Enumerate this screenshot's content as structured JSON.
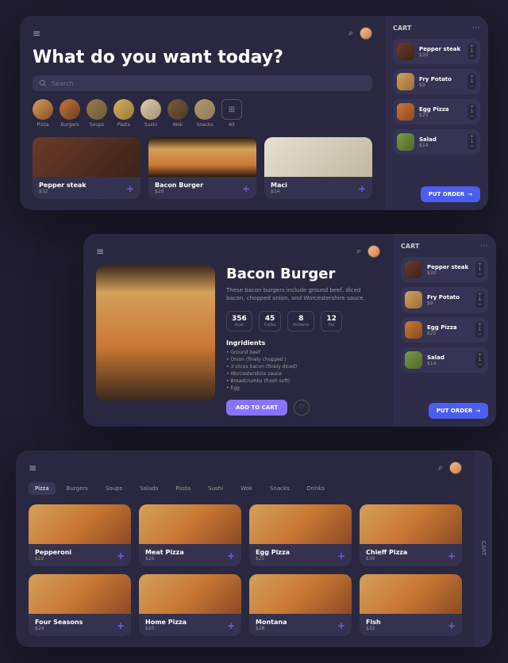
{
  "home": {
    "hero": "What do you want today?",
    "search_placeholder": "Search",
    "categories": [
      {
        "label": "Pizza"
      },
      {
        "label": "Burgers"
      },
      {
        "label": "Soups"
      },
      {
        "label": "Pasta"
      },
      {
        "label": "Sushi"
      },
      {
        "label": "Wok"
      },
      {
        "label": "Snacks"
      }
    ],
    "cat_all": "All",
    "cards": [
      {
        "name": "Pepper steak",
        "price": "$32",
        "cls": "steak"
      },
      {
        "name": "Bacon Burger",
        "price": "$20",
        "cls": "burger"
      },
      {
        "name": "Maci",
        "price": "$14",
        "cls": "sushi"
      }
    ]
  },
  "cart": {
    "title": "CART",
    "put_order": "PUT ORDER",
    "items": [
      {
        "name": "Pepper steak",
        "price": "$30",
        "qty": "1",
        "cls": "steak"
      },
      {
        "name": "Fry Potato",
        "price": "$9",
        "qty": "1",
        "cls": "fries"
      },
      {
        "name": "Egg Pizza",
        "price": "$25",
        "qty": "1",
        "cls": "pizza"
      },
      {
        "name": "Salad",
        "price": "$14",
        "qty": "1",
        "cls": "salad"
      }
    ]
  },
  "detail": {
    "title": "Bacon Burger",
    "desc": "These bacon burgers include ground beef, diced bacon, chopped onion, and Worcestershire sauce.",
    "nutrition": [
      {
        "v": "356",
        "l": "Kcal"
      },
      {
        "v": "45",
        "l": "Carbs"
      },
      {
        "v": "8",
        "l": "Proteins"
      },
      {
        "v": "12",
        "l": "Fat"
      }
    ],
    "ing_title": "Ingridients",
    "ingredients": [
      "• Ground beef",
      "• Onion (finely chopped )",
      "• 3 slices bacon (finely diced)",
      "• Worcestershire sauce",
      "• Breadcrumbs (fresh soft)",
      "• Egg"
    ],
    "add_to_cart": "ADD TO CART"
  },
  "browse": {
    "tabs": [
      "Pizza",
      "Burgers",
      "Soups",
      "Salads",
      "Pasta",
      "Sushi",
      "Wok",
      "Snacks",
      "Drinks"
    ],
    "active_tab": 0,
    "cards": [
      {
        "name": "Pepperoni",
        "price": "$22"
      },
      {
        "name": "Meat Pizza",
        "price": "$26"
      },
      {
        "name": "Egg Pizza",
        "price": "$25"
      },
      {
        "name": "Chieff Pizza",
        "price": "$30"
      },
      {
        "name": "Four Seasons",
        "price": "$24"
      },
      {
        "name": "Home Pizza",
        "price": "$20"
      },
      {
        "name": "Montana",
        "price": "$28"
      },
      {
        "name": "Fish",
        "price": "$32"
      }
    ],
    "cart_min": "CART"
  }
}
